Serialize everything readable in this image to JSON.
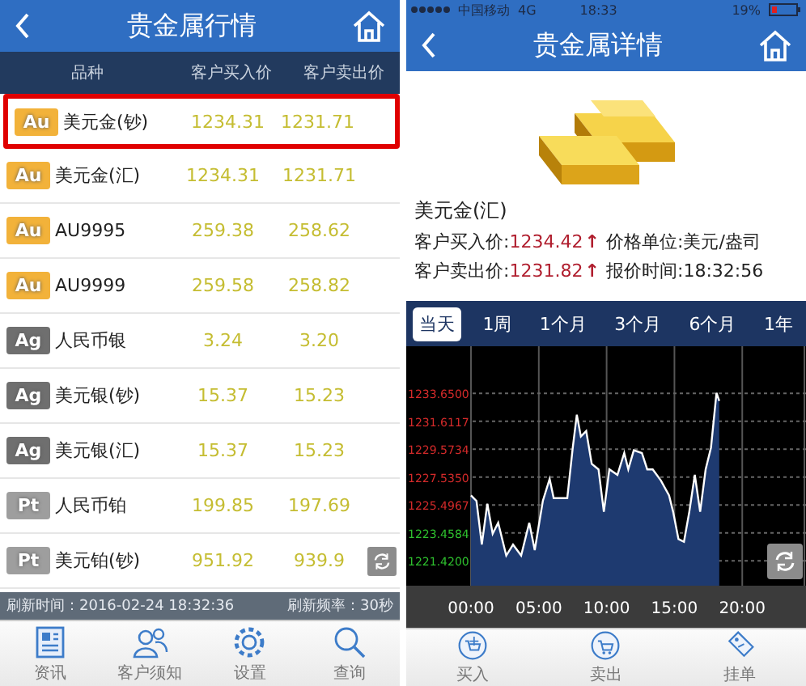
{
  "quotes": {
    "title": "贵金属行情",
    "columns": [
      "品种",
      "客户买入价",
      "客户卖出价"
    ],
    "rows": [
      {
        "badge": "Au",
        "color": "#f2b23a",
        "name": "美元金(钞)",
        "buy": "1234.31",
        "sell": "1231.71",
        "highlighted": true
      },
      {
        "badge": "Au",
        "color": "#f2b23a",
        "name": "美元金(汇)",
        "buy": "1234.31",
        "sell": "1231.71",
        "highlighted": false
      },
      {
        "badge": "Au",
        "color": "#f2b23a",
        "name": "AU9995",
        "buy": "259.38",
        "sell": "258.62",
        "highlighted": false
      },
      {
        "badge": "Au",
        "color": "#f2b23a",
        "name": "AU9999",
        "buy": "259.58",
        "sell": "258.82",
        "highlighted": false
      },
      {
        "badge": "Ag",
        "color": "#6f6f6f",
        "name": "人民币银",
        "buy": "3.24",
        "sell": "3.20",
        "highlighted": false
      },
      {
        "badge": "Ag",
        "color": "#6f6f6f",
        "name": "美元银(钞)",
        "buy": "15.37",
        "sell": "15.23",
        "highlighted": false
      },
      {
        "badge": "Ag",
        "color": "#6f6f6f",
        "name": "美元银(汇)",
        "buy": "15.37",
        "sell": "15.23",
        "highlighted": false
      },
      {
        "badge": "Pt",
        "color": "#9e9e9e",
        "name": "人民币铂",
        "buy": "199.85",
        "sell": "197.69",
        "highlighted": false
      },
      {
        "badge": "Pt",
        "color": "#9e9e9e",
        "name": "美元铂(钞)",
        "buy": "951.92",
        "sell": "939.9",
        "highlighted": false
      }
    ],
    "refresh_time": "刷新时间：2016-02-24 18:32:36",
    "refresh_rate": "刷新频率：30秒",
    "tabs": [
      {
        "label": "资讯",
        "kind": "news"
      },
      {
        "label": "客户须知",
        "kind": "people"
      },
      {
        "label": "设置",
        "kind": "settings"
      },
      {
        "label": "查询",
        "kind": "search"
      }
    ]
  },
  "detail": {
    "status_bar": {
      "carrier": "中国移动",
      "network": "4G",
      "time": "18:33",
      "battery": "19%"
    },
    "title": "贵金属详情",
    "name": "美元金(汇)",
    "buy_label": "客户买入价:",
    "buy": "1234.42",
    "buy_arrow": "↑",
    "unit": "价格单位:美元/盎司",
    "sell_label": "客户卖出价:",
    "sell": "1231.82",
    "sell_arrow": "↑",
    "quote_time": "报价时间:18:32:56",
    "periods": [
      {
        "label": "当天",
        "selected": true
      },
      {
        "label": "1周",
        "selected": false
      },
      {
        "label": "1个月",
        "selected": false
      },
      {
        "label": "3个月",
        "selected": false
      },
      {
        "label": "6个月",
        "selected": false
      },
      {
        "label": "1年",
        "selected": false
      }
    ],
    "chart_data": {
      "type": "area",
      "grid": true,
      "xlim": [
        0,
        24.7
      ],
      "ylim": [
        1219.6,
        1237.1
      ],
      "xticks": [
        {
          "value": 0,
          "label": "00:00"
        },
        {
          "value": 5,
          "label": "05:00"
        },
        {
          "value": 10,
          "label": "10:00"
        },
        {
          "value": 15,
          "label": "15:00"
        },
        {
          "value": 20,
          "label": "20:00"
        }
      ],
      "yticks": [
        {
          "value": 1233.65,
          "label": "1233.6500"
        },
        {
          "value": 1231.6117,
          "label": "1231.6117"
        },
        {
          "value": 1229.5734,
          "label": "1229.5734"
        },
        {
          "value": 1227.535,
          "label": "1227.5350"
        },
        {
          "value": 1225.4967,
          "label": "1225.4967"
        },
        {
          "value": 1223.4584,
          "label": "1223.4584"
        },
        {
          "value": 1221.42,
          "label": "1221.4200"
        }
      ],
      "x": [
        0,
        0.4,
        0.8,
        1.2,
        1.6,
        2.0,
        2.6,
        3.1,
        3.7,
        4.3,
        4.7,
        5.3,
        5.8,
        6.1,
        7.1,
        7.5,
        7.8,
        8.1,
        8.5,
        8.9,
        9.4,
        9.8,
        10.2,
        10.8,
        11.3,
        11.6,
        12.0,
        12.6,
        13.0,
        13.4,
        14.0,
        14.6,
        14.9,
        15.3,
        15.7,
        16.1,
        16.5,
        16.9,
        17.3,
        17.7,
        18.1,
        18.3
      ],
      "series": [
        {
          "color": "#ffffff",
          "values": [
            1226.2,
            1225.8,
            1222.6,
            1225.6,
            1223.4,
            1224.2,
            1221.8,
            1222.6,
            1221.8,
            1224.2,
            1222.2,
            1225.8,
            1227.4,
            1226.0,
            1226.0,
            1229.7,
            1232.1,
            1230.5,
            1230.9,
            1228.5,
            1228.1,
            1225.0,
            1228.1,
            1227.7,
            1229.3,
            1228.1,
            1229.5,
            1229.3,
            1228.1,
            1228.1,
            1227.3,
            1226.2,
            1225.0,
            1223.0,
            1222.8,
            1225.0,
            1227.7,
            1225.0,
            1228.1,
            1229.7,
            1233.7,
            1233.1
          ]
        }
      ]
    },
    "y_axis_labels": [
      {
        "color": "#d42a2a"
      },
      {
        "color": "#d42a2a"
      },
      {
        "color": "#d42a2a"
      },
      {
        "color": "#d42a2a"
      },
      {
        "color": "#d42a2a"
      },
      {
        "color": "#2ec02e"
      },
      {
        "color": "#2ec02e"
      }
    ],
    "actions": [
      {
        "label": "买入",
        "kind": "buy"
      },
      {
        "label": "卖出",
        "kind": "sell"
      },
      {
        "label": "挂单",
        "kind": "order"
      }
    ]
  }
}
